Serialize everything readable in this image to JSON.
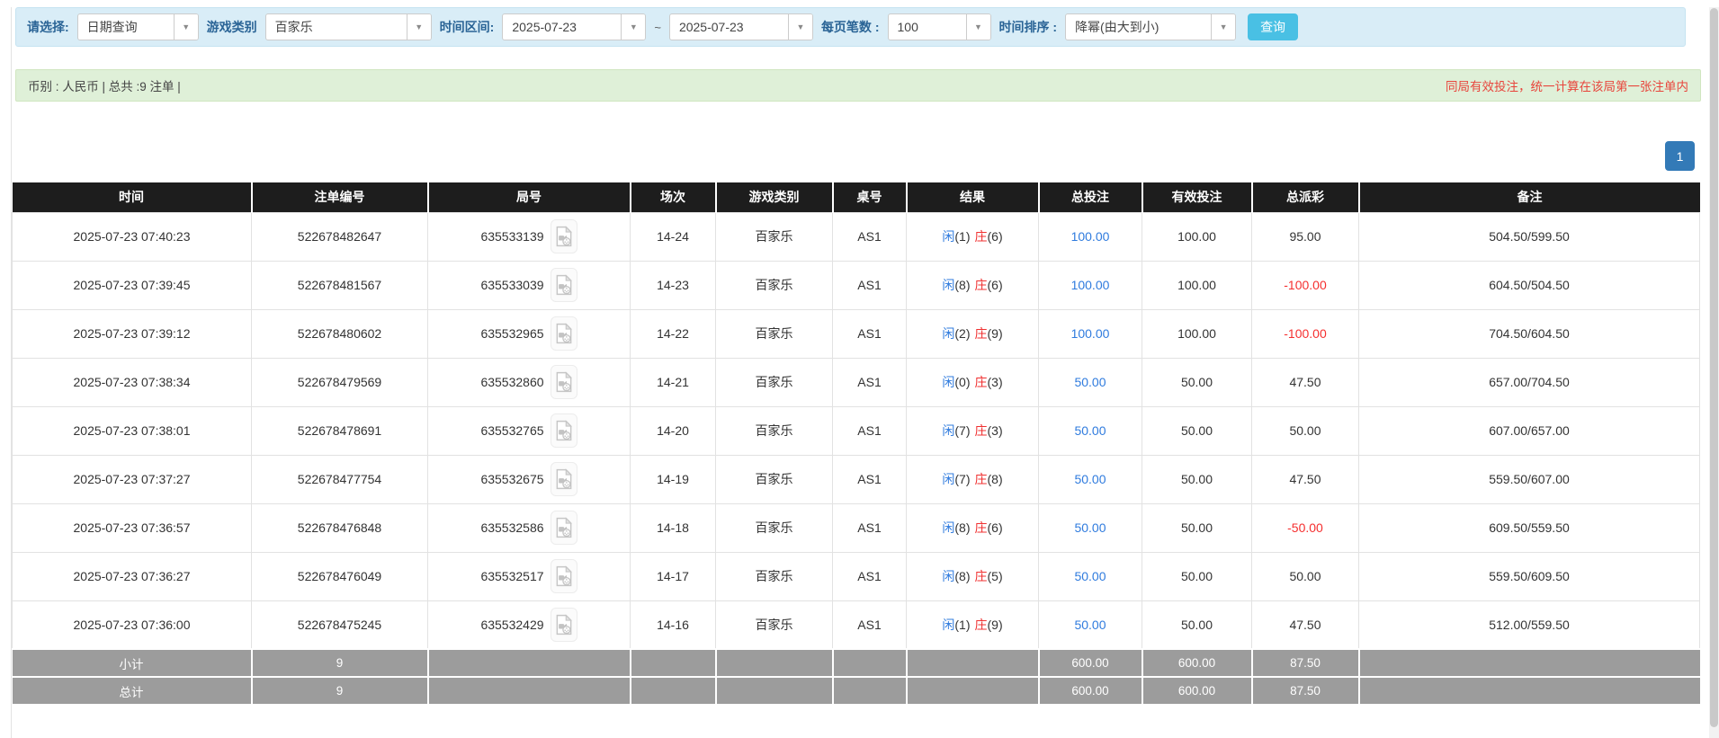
{
  "toolbar": {
    "select_label": "请选择:",
    "select_value": "日期查询",
    "game_type_label": "游戏类别",
    "game_type_value": "百家乐",
    "time_range_label": "时间区间:",
    "date_from": "2025-07-23",
    "tilde": "~",
    "date_to": "2025-07-23",
    "page_size_label": "每页笔数 :",
    "page_size_value": "100",
    "sort_label": "时间排序 :",
    "sort_value": "降幂(由大到小)",
    "search_button": "查询"
  },
  "summary": {
    "left_text": "币别 : 人民币 | 总共 :9 注单 |",
    "right_note": "同局有效投注，统一计算在该局第一张注单内"
  },
  "pagination": {
    "page": "1"
  },
  "table": {
    "headers": [
      "时间",
      "注单编号",
      "局号",
      "场次",
      "游戏类别",
      "桌号",
      "结果",
      "总投注",
      "有效投注",
      "总派彩",
      "备注"
    ],
    "result_player_label": "闲",
    "result_banker_label": "庄",
    "video_icon": "video-replay-icon",
    "rows": [
      {
        "time": "2025-07-23 07:40:23",
        "bet_no": "522678482647",
        "round_no": "635533139",
        "session": "14-24",
        "game": "百家乐",
        "table_no": "AS1",
        "player_result": "(1)",
        "banker_result": "(6)",
        "total_bet": "100.00",
        "valid_bet": "100.00",
        "payout": "95.00",
        "remark": "504.50/599.50"
      },
      {
        "time": "2025-07-23 07:39:45",
        "bet_no": "522678481567",
        "round_no": "635533039",
        "session": "14-23",
        "game": "百家乐",
        "table_no": "AS1",
        "player_result": "(8)",
        "banker_result": "(6)",
        "total_bet": "100.00",
        "valid_bet": "100.00",
        "payout": "-100.00",
        "remark": "604.50/504.50"
      },
      {
        "time": "2025-07-23 07:39:12",
        "bet_no": "522678480602",
        "round_no": "635532965",
        "session": "14-22",
        "game": "百家乐",
        "table_no": "AS1",
        "player_result": "(2)",
        "banker_result": "(9)",
        "total_bet": "100.00",
        "valid_bet": "100.00",
        "payout": "-100.00",
        "remark": "704.50/604.50"
      },
      {
        "time": "2025-07-23 07:38:34",
        "bet_no": "522678479569",
        "round_no": "635532860",
        "session": "14-21",
        "game": "百家乐",
        "table_no": "AS1",
        "player_result": "(0)",
        "banker_result": "(3)",
        "total_bet": "50.00",
        "valid_bet": "50.00",
        "payout": "47.50",
        "remark": "657.00/704.50"
      },
      {
        "time": "2025-07-23 07:38:01",
        "bet_no": "522678478691",
        "round_no": "635532765",
        "session": "14-20",
        "game": "百家乐",
        "table_no": "AS1",
        "player_result": "(7)",
        "banker_result": "(3)",
        "total_bet": "50.00",
        "valid_bet": "50.00",
        "payout": "50.00",
        "remark": "607.00/657.00"
      },
      {
        "time": "2025-07-23 07:37:27",
        "bet_no": "522678477754",
        "round_no": "635532675",
        "session": "14-19",
        "game": "百家乐",
        "table_no": "AS1",
        "player_result": "(7)",
        "banker_result": "(8)",
        "total_bet": "50.00",
        "valid_bet": "50.00",
        "payout": "47.50",
        "remark": "559.50/607.00"
      },
      {
        "time": "2025-07-23 07:36:57",
        "bet_no": "522678476848",
        "round_no": "635532586",
        "session": "14-18",
        "game": "百家乐",
        "table_no": "AS1",
        "player_result": "(8)",
        "banker_result": "(6)",
        "total_bet": "50.00",
        "valid_bet": "50.00",
        "payout": "-50.00",
        "remark": "609.50/559.50"
      },
      {
        "time": "2025-07-23 07:36:27",
        "bet_no": "522678476049",
        "round_no": "635532517",
        "session": "14-17",
        "game": "百家乐",
        "table_no": "AS1",
        "player_result": "(8)",
        "banker_result": "(5)",
        "total_bet": "50.00",
        "valid_bet": "50.00",
        "payout": "50.00",
        "remark": "559.50/609.50"
      },
      {
        "time": "2025-07-23 07:36:00",
        "bet_no": "522678475245",
        "round_no": "635532429",
        "session": "14-16",
        "game": "百家乐",
        "table_no": "AS1",
        "player_result": "(1)",
        "banker_result": "(9)",
        "total_bet": "50.00",
        "valid_bet": "50.00",
        "payout": "47.50",
        "remark": "512.00/559.50"
      }
    ],
    "subtotal": {
      "label": "小计",
      "count": "9",
      "total_bet": "600.00",
      "valid_bet": "600.00",
      "payout": "87.50"
    },
    "total": {
      "label": "总计",
      "count": "9",
      "total_bet": "600.00",
      "valid_bet": "600.00",
      "payout": "87.50"
    }
  },
  "colors": {
    "accent-blue": "#337ab7",
    "link-blue": "#2f7bde",
    "player-blue": "#2f7bde",
    "banker-red": "#f03030",
    "negative-red": "#f52f2f",
    "note-red": "#e8453c",
    "toolbar-bg": "#d9edf7",
    "toolbar-border": "#c5e3f1",
    "label-blue": "#2a6496",
    "button-bg": "#49c0e4",
    "summary-bg": "#dff0d8",
    "summary-border": "#d0e6c0",
    "summary-text": "#444444",
    "header-bg": "#1d1d1d",
    "footer-bg": "#9c9c9c",
    "row-border": "#e2e2e2",
    "text": "#333333"
  }
}
